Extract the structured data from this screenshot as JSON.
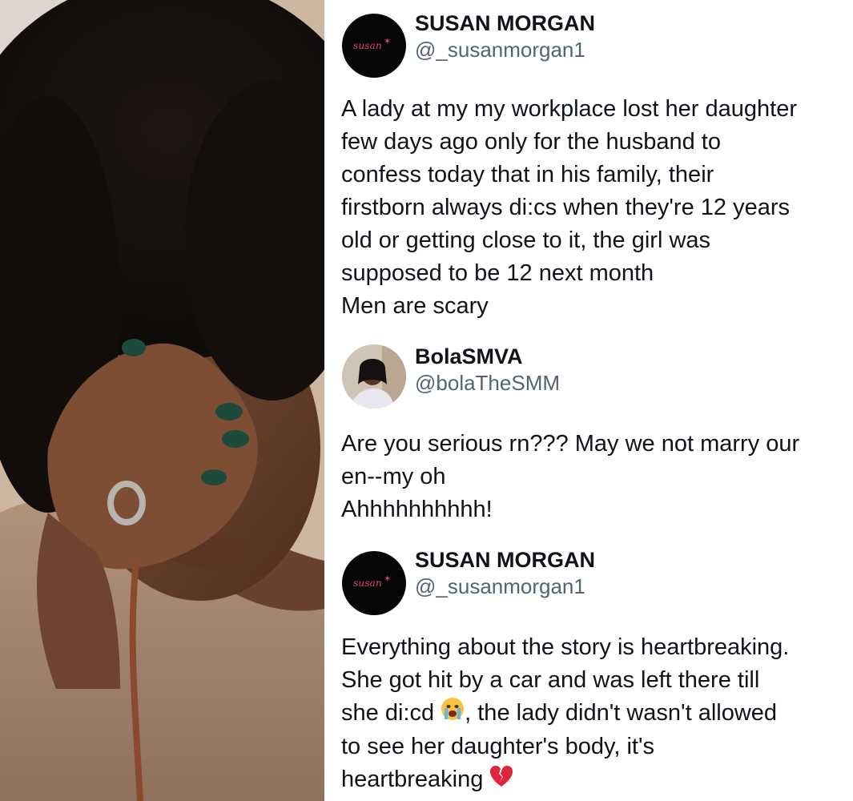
{
  "tweets": [
    {
      "name": "SUSAN MORGAN",
      "handle": "@_susanmorgan1",
      "avatar_logo_text": "susan",
      "avatar_icon": "logo",
      "body_lines": [
        "A lady at my my workplace lost her daughter",
        "few days ago only for the husband to",
        "confess today that in his family, their",
        "firstborn always di:cs when they're 12 years",
        "old or getting close to it, the girl was",
        "supposed to be 12 next month",
        "Men are scary"
      ]
    },
    {
      "name": "BolaSMVA",
      "handle": "@bolaTheSMM",
      "avatar_icon": "profile-photo",
      "body_lines": [
        "Are you serious rn??? May we not marry our",
        "en--my oh",
        "Ahhhhhhhhhh!"
      ]
    },
    {
      "name": "SUSAN MORGAN",
      "handle": "@_susanmorgan1",
      "avatar_logo_text": "susan",
      "avatar_icon": "logo",
      "body_lines": [
        "Everything about the story is heartbreaking.",
        "She got hit by a car and was left there till",
        "she di:cd",
        ", the lady didn't wasn't allowed",
        "to see her daughter's body, it's",
        "heartbreaking"
      ],
      "emoji": [
        "loudly-crying-face-icon",
        "broken-heart-icon"
      ]
    }
  ],
  "colors": {
    "handle": "#536471",
    "text": "#0f1419",
    "logo_pink": "#e7417a",
    "nail_green": "#1d4a3a"
  }
}
